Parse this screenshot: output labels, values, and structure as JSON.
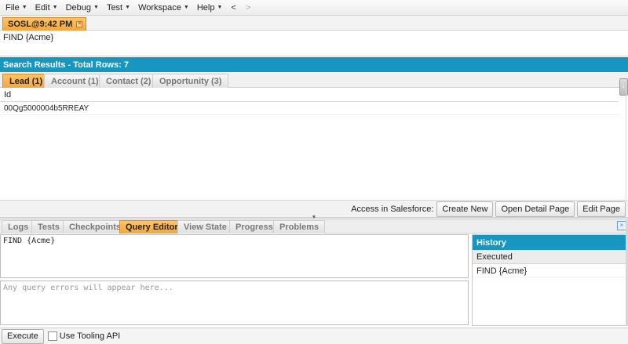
{
  "menu": [
    {
      "label": "File"
    },
    {
      "label": "Edit"
    },
    {
      "label": "Debug"
    },
    {
      "label": "Test"
    },
    {
      "label": "Workspace"
    },
    {
      "label": "Help"
    }
  ],
  "nav": {
    "back": "<",
    "forward": ">"
  },
  "editor_tab": {
    "label": "SOSL@9:42 PM"
  },
  "query_text": "FIND {Acme}",
  "results": {
    "header": "Search Results - Total Rows: 7",
    "tabs": [
      "Lead (1)",
      "Account (1)",
      "Contact (2)",
      "Opportunity (3)"
    ],
    "column": "Id",
    "rows": [
      "00Qg5000004b5RREAY"
    ]
  },
  "actions": {
    "label": "Access in Salesforce:",
    "create_new": "Create New",
    "open_detail": "Open Detail Page",
    "edit_page": "Edit Page"
  },
  "bottom_tabs": [
    "Logs",
    "Tests",
    "Checkpoints",
    "Query Editor",
    "View State",
    "Progress",
    "Problems"
  ],
  "query_editor": {
    "text": "FIND {Acme}",
    "error_placeholder": "Any query errors will appear here..."
  },
  "history": {
    "title": "History",
    "column": "Executed",
    "items": [
      "FIND {Acme}"
    ]
  },
  "toolbar": {
    "execute": "Execute",
    "tooling_api": "Use Tooling API"
  },
  "colors": {
    "accent_blue": "#1797c0",
    "active_tab_orange": "#f6a53a"
  }
}
